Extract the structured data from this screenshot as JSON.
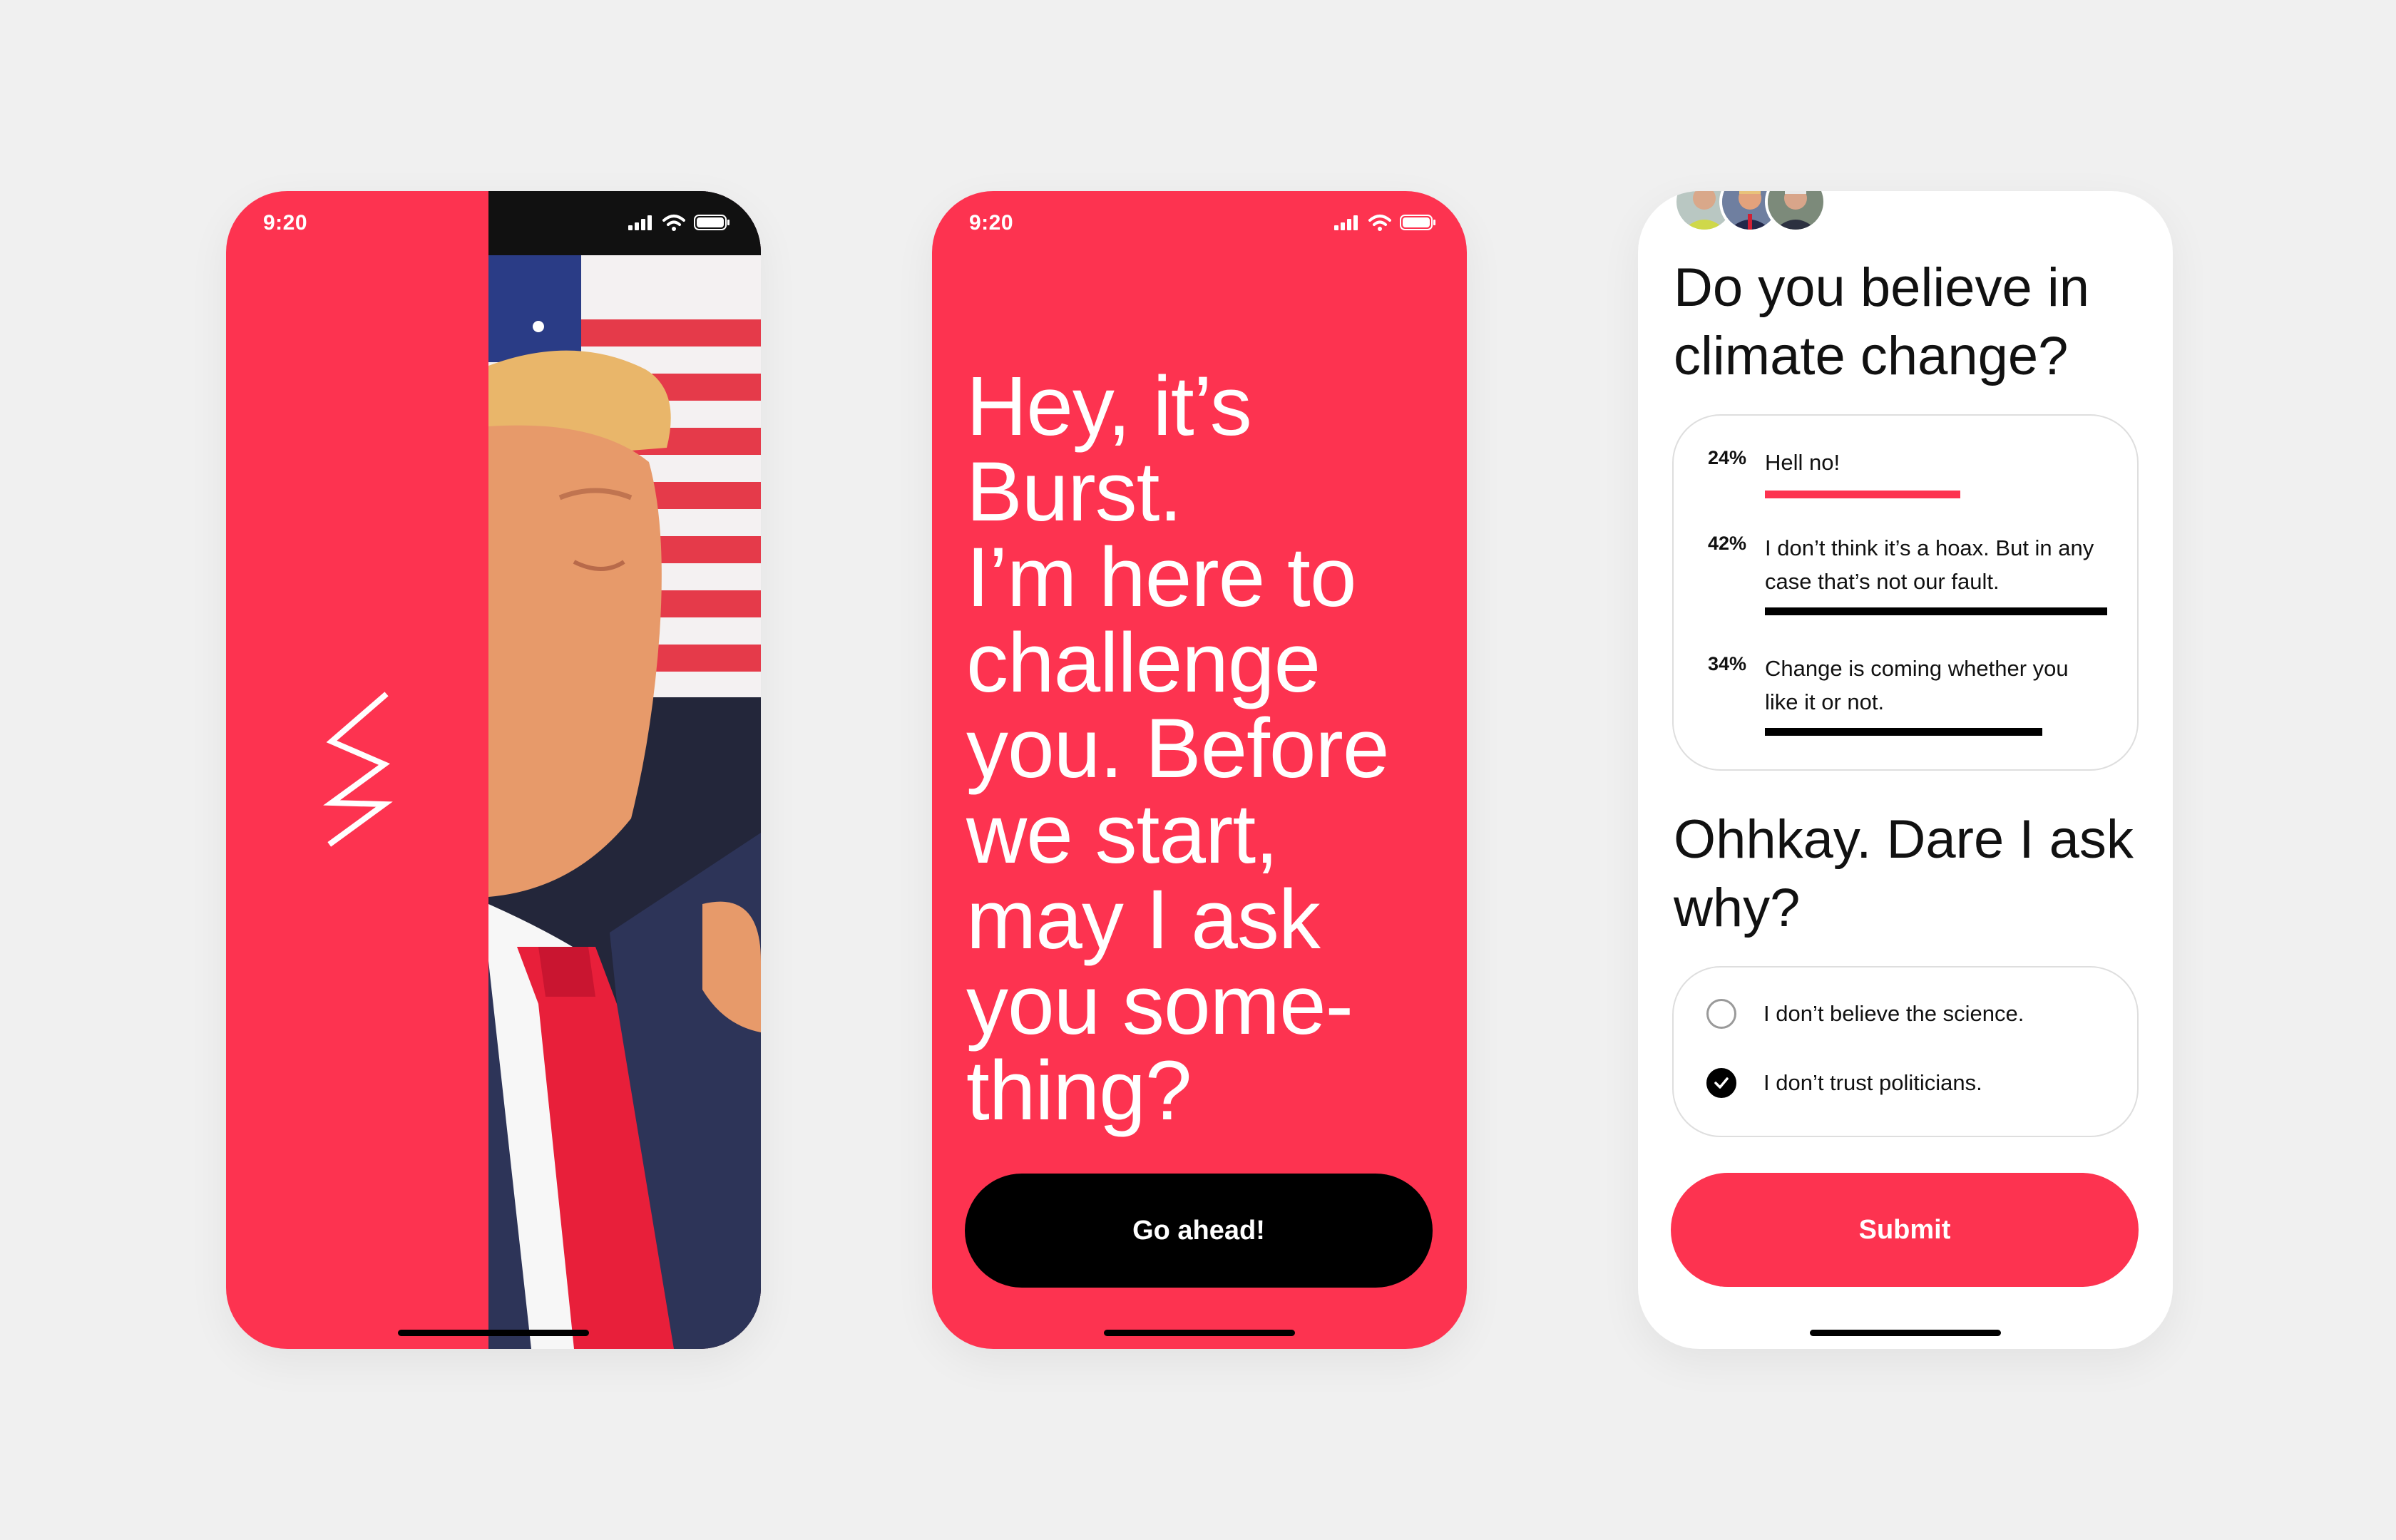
{
  "colors": {
    "brand": "#fd3350",
    "dark": "#000000",
    "background": "#f0f0f0"
  },
  "screens": [
    {
      "status_time": "9:20",
      "logo_icon": "lightning-bolt-icon",
      "photo": "portrait-photo-with-flag"
    },
    {
      "status_time": "9:20",
      "headline_lines": [
        "Hey, it’s",
        "Burst.",
        "I’m here to",
        "challenge",
        "you. Before",
        "we start,",
        "may I ask",
        "you some-",
        "thing?"
      ],
      "cta_label": "Go ahead!"
    },
    {
      "question": "Do you believe in climate change?",
      "poll": [
        {
          "percent_label": "24%",
          "value": 0.24,
          "text": "Hell no!",
          "bar_color": "#fd3350"
        },
        {
          "percent_label": "42%",
          "value": 0.42,
          "text": "I don’t think it’s a hoax. But in any case that’s not our fault.",
          "bar_color": "#000000"
        },
        {
          "percent_label": "34%",
          "value": 0.34,
          "text": "Change is coming whether you like it or not.",
          "bar_color": "#000000"
        }
      ],
      "followup_question": "Ohhkay. Dare I ask why?",
      "choices": [
        {
          "label": "I don’t believe the science.",
          "checked": false
        },
        {
          "label": "I don’t trust politicians.",
          "checked": true
        }
      ],
      "submit_label": "Submit"
    }
  ]
}
